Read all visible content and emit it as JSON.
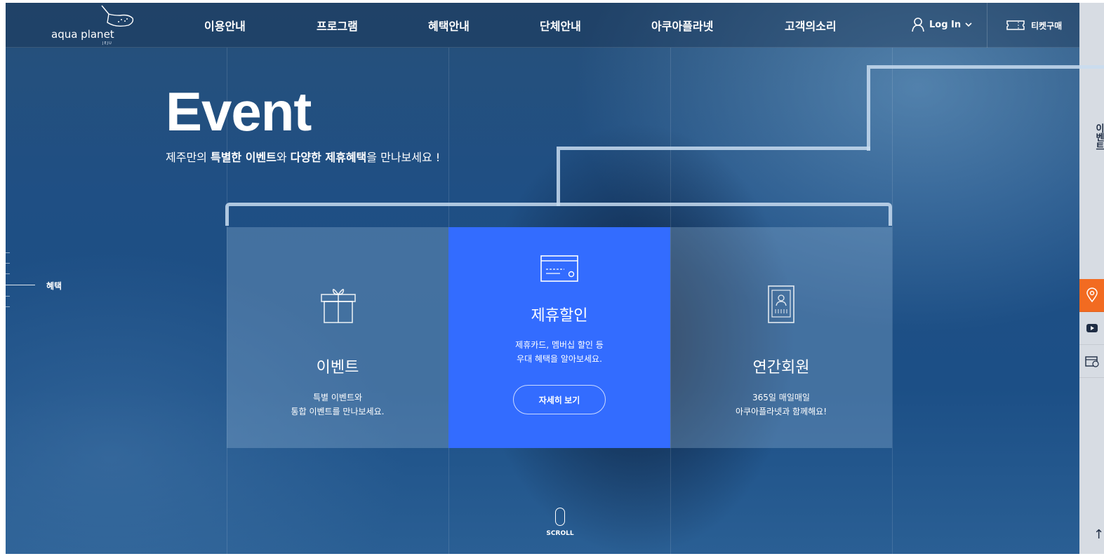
{
  "brand": {
    "logo_text": "aqua planet",
    "logo_sub": "JEJU"
  },
  "nav": [
    "이용안내",
    "프로그램",
    "혜택안내",
    "단체안내",
    "아쿠아플라넷",
    "고객의소리"
  ],
  "login": {
    "label": "Log In"
  },
  "ticket": {
    "label": "티켓구매"
  },
  "side": {
    "label": "이벤트"
  },
  "hero": {
    "title": "Event",
    "sub_prefix": "제주만의 ",
    "sub_b1": "특별한 이벤트",
    "sub_mid": "와 ",
    "sub_b2": "다양한 제휴혜택",
    "sub_suffix": "을 만나보세요 !"
  },
  "section_indicator": {
    "label": "혜택"
  },
  "cards": [
    {
      "title": "이벤트",
      "line1": "특별 이벤트와",
      "line2": "통합 이벤트를 만나보세요."
    },
    {
      "title": "제휴할인",
      "line1": "제휴카드, 멤버십 할인 등",
      "line2": "우대 혜택을 알아보세요.",
      "button": "자세히 보기"
    },
    {
      "title": "연간회원",
      "line1": "365일 매일매일",
      "line2": "아쿠아플라넷과 함께해요!"
    }
  ],
  "scroll": {
    "label": "SCROLL"
  },
  "colors": {
    "accent_blue": "#336cff",
    "side_orange": "#f26b21"
  }
}
